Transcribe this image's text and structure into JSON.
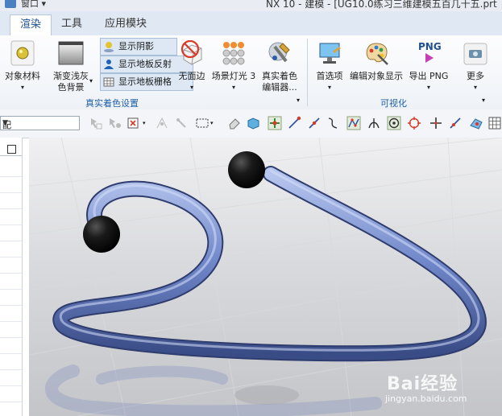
{
  "titlebar": {
    "window_menu": "窗口 ▾",
    "title": "NX 10 - 建模 - [UG10.0练习三维建模五百几十五.prt"
  },
  "tabs": [
    {
      "label": "渲染",
      "active": true
    },
    {
      "label": "工具",
      "active": false
    },
    {
      "label": "应用模块",
      "active": false
    }
  ],
  "ribbon": {
    "object_material": {
      "line1": "对象材料",
      "arrow": "▾"
    },
    "gradient_bg": {
      "line1": "渐变浅灰",
      "line2": "色背景"
    },
    "toggles": [
      {
        "label": "显示阴影",
        "on": true
      },
      {
        "label": "显示地板反射",
        "on": true
      },
      {
        "label": "显示地板栅格",
        "on": true
      }
    ],
    "no_face_edge": {
      "label": "无面边"
    },
    "scene_light": {
      "label": "场景灯光 3"
    },
    "true_shading_editor": {
      "line1": "真实着色",
      "line2": "编辑器..."
    },
    "group1_label": "真实着色设置",
    "preferences": {
      "label": "首选项"
    },
    "edit_display": {
      "label": "编辑对象显示"
    },
    "export_png": {
      "icon_text": "PNG",
      "label": "导出 PNG"
    },
    "more": {
      "label": "更多"
    },
    "group2_label": "可视化"
  },
  "toolbar": {
    "filter_value": "配"
  },
  "colors": {
    "tube": "#6f86c9",
    "ball": "#111111",
    "accent": "#1d5fa8"
  },
  "watermark": {
    "brand": "Bai经验",
    "url": "jingyan.baidu.com"
  }
}
